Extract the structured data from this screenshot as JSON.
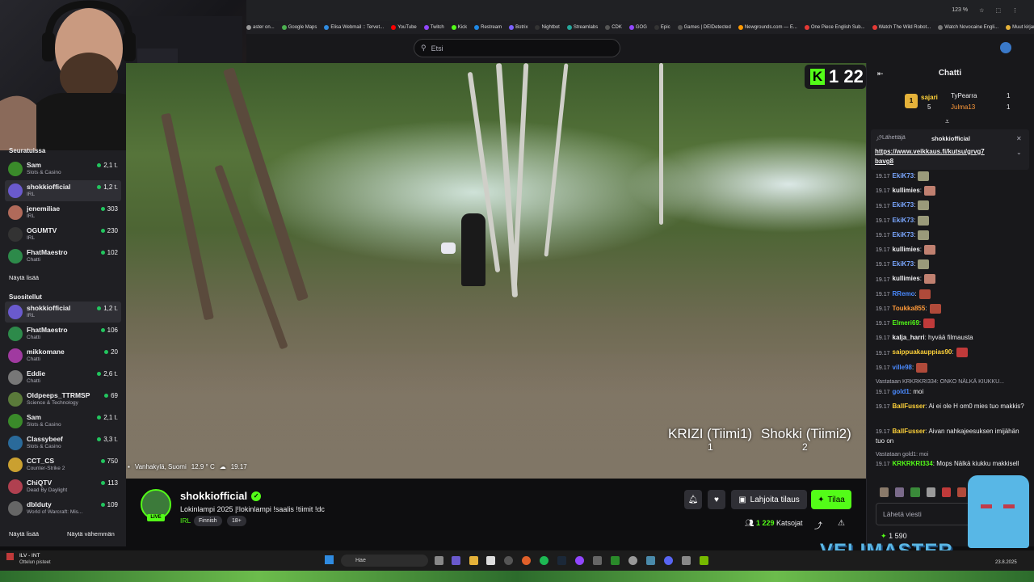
{
  "browser": {
    "zoom": "123 %",
    "bookmarks": [
      "aster on...",
      "Google Maps",
      "Elisa Webmail :: Tervet...",
      "YouTube",
      "Twitch",
      "Kick",
      "Restream",
      "Botrix",
      "Nightbot",
      "Streamlabs",
      "CDK",
      "GOG",
      "Epic",
      "Games | DEIDetected",
      "Newgrounds.com — E...",
      "One Piece English Sub...",
      "Watch The Wild Robot...",
      "Watch Novocaine Engli...",
      "Muut kirjanmerkit"
    ]
  },
  "header": {
    "search_placeholder": "Etsi"
  },
  "sidebar": {
    "section1_title": "Seuratuissa",
    "followed": [
      {
        "name": "Sam",
        "category": "Slots & Casino",
        "viewers": "2,1 t.",
        "color": "#3a8a2a"
      },
      {
        "name": "shokkiofficial",
        "category": "IRL",
        "viewers": "1,2 t.",
        "color": "#6a5acd",
        "selected": true
      },
      {
        "name": "jenemiliae",
        "category": "IRL",
        "viewers": "303",
        "color": "#b06a5a"
      },
      {
        "name": "OGUMTV",
        "category": "IRL",
        "viewers": "230",
        "color": "#333"
      },
      {
        "name": "FhatMaestro",
        "category": "Chatti",
        "viewers": "102",
        "color": "#2d8a4a"
      }
    ],
    "show_more": "Näytä lisää",
    "section2_title": "Suositellut",
    "recommended": [
      {
        "name": "shokkiofficial",
        "category": "IRL",
        "viewers": "1,2 t.",
        "color": "#6a5acd",
        "selected": true
      },
      {
        "name": "FhatMaestro",
        "category": "Chatti",
        "viewers": "106",
        "color": "#2d8a4a"
      },
      {
        "name": "mikkomane",
        "category": "Chatti",
        "viewers": "20",
        "color": "#a03aa0"
      },
      {
        "name": "Eddie",
        "category": "Chatti",
        "viewers": "2,6 t.",
        "color": "#777"
      },
      {
        "name": "Oldpeeps_TTRMSP",
        "category": "Science & Technology",
        "viewers": "69",
        "color": "#5a7a3a"
      },
      {
        "name": "Sam",
        "category": "Slots & Casino",
        "viewers": "2,1 t.",
        "color": "#3a8a2a"
      },
      {
        "name": "Classybeef",
        "category": "Slots & Casino",
        "viewers": "3,3 t.",
        "color": "#2a6a9a"
      },
      {
        "name": "CCT_CS",
        "category": "Counter-Strike 2",
        "viewers": "750",
        "color": "#caa030"
      },
      {
        "name": "ChiQTV",
        "category": "Dead By Daylight",
        "viewers": "113",
        "color": "#b04050"
      },
      {
        "name": "dbIduty",
        "category": "World of Warcraft: Mis...",
        "viewers": "109",
        "color": "#666"
      }
    ],
    "show_more2": "Näytä lisää",
    "show_less": "Näytä vähemmän"
  },
  "video": {
    "kick_viewers": "1 22",
    "team1": "KRIZI (Tiimi1)",
    "team1_score": "1",
    "team2": "Shokki (Tiimi2)",
    "team2_score": "2",
    "location": "Vanhakylä, Suomi",
    "temp": "12.9 ° C",
    "time": "19.17"
  },
  "stream": {
    "channel": "shokkiofficial",
    "live": "LIVE",
    "title": "Lokinlampi 2025 |!lokinlampi !saalis !tiimit !dc",
    "category": "IRL",
    "tags": [
      "Finnish",
      "18+"
    ],
    "gift_label": "Lahjoita tilaus",
    "subscribe_label": "Tilaa",
    "viewer_count": "1 229",
    "viewers_label": "Katsojat"
  },
  "chat": {
    "title": "Chatti",
    "leaderboard": [
      {
        "name": "sajari",
        "val": "5"
      },
      {
        "name": "TyPearra",
        "val": "1"
      },
      {
        "name": "Julma13",
        "val": "1"
      }
    ],
    "pinned_by": "Lähettäjä",
    "pinned_user": "shokkiofficial",
    "pinned_link": "https://www.veikkaus.fi/kutsu/grvg7bavg8",
    "messages": [
      {
        "time": "19.17",
        "user": "EkiK73",
        "text": "",
        "ucolor": "#7aa7ff",
        "emote": "#9a9a7a"
      },
      {
        "time": "19.17",
        "user": "kullimies",
        "text": "",
        "ucolor": "#efeff1",
        "emote": "#c08070"
      },
      {
        "time": "19.17",
        "user": "EkiK73",
        "text": "",
        "ucolor": "#7aa7ff",
        "emote": "#9a9a7a"
      },
      {
        "time": "19.17",
        "user": "EkiK73",
        "text": "",
        "ucolor": "#7aa7ff",
        "emote": "#9a9a7a"
      },
      {
        "time": "19.17",
        "user": "EkiK73",
        "text": "",
        "ucolor": "#7aa7ff",
        "emote": "#9a9a7a"
      },
      {
        "time": "19.17",
        "user": "kullimies",
        "text": "",
        "ucolor": "#efeff1",
        "emote": "#c08070"
      },
      {
        "time": "19.17",
        "user": "EkiK73",
        "text": "",
        "ucolor": "#7aa7ff",
        "emote": "#9a9a7a"
      },
      {
        "time": "19.17",
        "user": "kullimies",
        "text": "",
        "ucolor": "#efeff1",
        "emote": "#c08070"
      },
      {
        "time": "19.17",
        "user": "RRemo",
        "text": "",
        "ucolor": "#4a8aff",
        "emote": "#b04a3a"
      },
      {
        "time": "19.17",
        "user": "Toukka855",
        "text": "",
        "ucolor": "#ff9a3a",
        "emote": "#b04a3a"
      },
      {
        "time": "19.17",
        "user": "Elmeri69",
        "text": "",
        "ucolor": "#53fc18",
        "emote": "#c03a3a"
      },
      {
        "time": "19.17",
        "user": "kalja_harri",
        "text": "hyvää filmausta",
        "ucolor": "#efeff1",
        "emote": ""
      },
      {
        "time": "19.17",
        "user": "saippuakauppias90",
        "text": "",
        "ucolor": "#ffd23a",
        "emote": "#c03a3a"
      },
      {
        "time": "19.17",
        "user": "ville98",
        "text": "",
        "ucolor": "#4a8aff",
        "emote": "#b04a3a"
      }
    ],
    "reply1_ctx": "Vastataan KRKRKRI334: ONKO NÄLKÄ KIUKKU...",
    "reply1": {
      "time": "19.17",
      "user": "gold1",
      "text": "moi",
      "ucolor": "#4a8aff"
    },
    "msg_b1": {
      "time": "19.17",
      "user": "BallFusser",
      "text": "Ai ei ole H om0 mies tuo makkis?",
      "ucolor": "#ffd23a"
    },
    "msg_b2": {
      "time": "19.17",
      "user": "BallFusser",
      "text": "Aivan nahkajeesuksen imijähän tuo on",
      "ucolor": "#ffd23a"
    },
    "reply2_ctx": "Vastataan gold1: moi",
    "reply2": {
      "time": "19.17",
      "user": "KRKRKRI334",
      "text": "Mops Nälkä kiukku makkisell",
      "ucolor": "#53fc18"
    },
    "input_placeholder": "Lähetä viesti",
    "points": "1 590"
  },
  "taskbar": {
    "search": "Hae",
    "notif_title": "ILV - INT",
    "notif_sub": "Ottelun pisteet",
    "date": "23.8.2025"
  },
  "overlay": {
    "brand": "VELIMASTER"
  }
}
